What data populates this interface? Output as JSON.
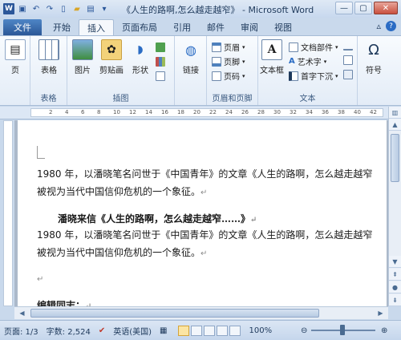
{
  "window": {
    "title": "《人生的路啊,怎么越走越窄》 - Microsoft Word",
    "qat_icons": [
      "word-logo-icon",
      "save-icon",
      "undo-icon",
      "redo-icon",
      "new-document-icon",
      "open-folder-icon",
      "print-icon",
      "customize-qat-icon"
    ],
    "controls": [
      "minimize",
      "maximize",
      "close"
    ]
  },
  "tabs": {
    "file": "文件",
    "items": [
      "开始",
      "插入",
      "页面布局",
      "引用",
      "邮件",
      "审阅",
      "视图"
    ],
    "active": "插入"
  },
  "ribbon": {
    "pages_group": {
      "page_label": "页"
    },
    "table_group": {
      "button": "表格",
      "label": "表格"
    },
    "illustrations_group": {
      "buttons": [
        "图片",
        "剪贴画",
        "形状"
      ],
      "label": "插图"
    },
    "links_group": {
      "button": "链接"
    },
    "header_footer_group": {
      "items": [
        "页眉",
        "页脚",
        "页码"
      ],
      "label": "页眉和页脚"
    },
    "text_group": {
      "button": "文本框",
      "items": [
        "文档部件",
        "艺术字",
        "首字下沉"
      ],
      "label": "文本"
    },
    "symbols_group": {
      "button": "符号",
      "symbol_glyph": "Ω"
    }
  },
  "ruler": {
    "ticks": [
      "2",
      "4",
      "6",
      "8",
      "10",
      "12",
      "14",
      "16",
      "18",
      "20",
      "22",
      "24",
      "26",
      "28",
      "30",
      "32",
      "34",
      "36",
      "38",
      "40",
      "42"
    ]
  },
  "document": {
    "p1_line1": "1980 年，以潘晓笔名问世于《中国青年》的文章《人生的路啊，怎么越走越窄",
    "p1_line2": "被视为当代中国信仰危机的一个象征。",
    "heading": "潘晓来信《人生的路啊，怎么越走越窄……》",
    "p2_line1": "1980 年，以潘晓笔名问世于《中国青年》的文章《人生的路啊，怎么越走越窄",
    "p2_line2": "被视为当代中国信仰危机的一个象征。",
    "editor_note": "编辑同志：",
    "paragraph_mark": "↵"
  },
  "status_bar": {
    "page": "页面: 1/3",
    "words": "字数: 2,524",
    "language": "英语(美国)",
    "zoom": "100%",
    "zoom_level": 100
  }
}
